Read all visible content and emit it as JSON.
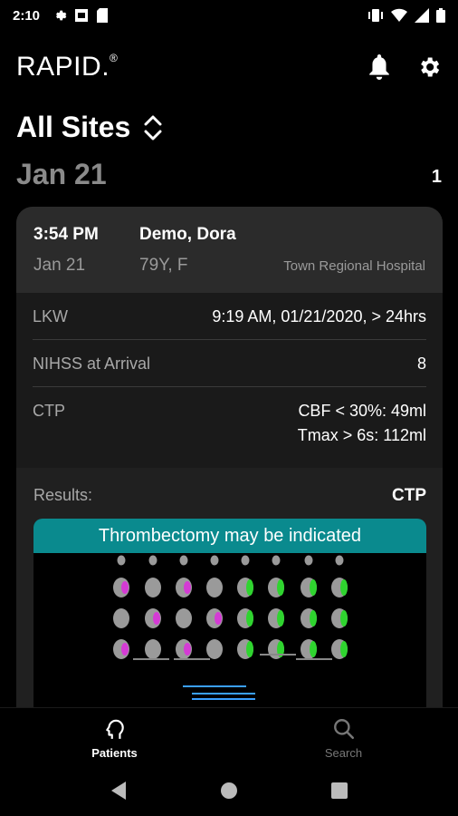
{
  "status": {
    "time": "2:10"
  },
  "app": {
    "logo": "RAPID",
    "logo_mark": "."
  },
  "site": {
    "title": "All Sites"
  },
  "group": {
    "date": "Jan 21",
    "count": "1"
  },
  "patient": {
    "time": "3:54 PM",
    "date": "Jan 21",
    "name": "Demo, Dora",
    "age_sex": "79Y, F",
    "hospital": "Town Regional Hospital",
    "rows": [
      {
        "label": "LKW",
        "value": "9:19 AM, 01/21/2020, > 24hrs"
      },
      {
        "label": "NIHSS at Arrival",
        "value": "8"
      },
      {
        "label": "CTP",
        "value_line1": "CBF < 30%: 49ml",
        "value_line2": "Tmax > 6s: 112ml"
      }
    ],
    "results_label": "Results:",
    "results_value": "CTP",
    "banner": "Thrombectomy may be indicated"
  },
  "nav": {
    "patients": "Patients",
    "search": "Search"
  },
  "colors": {
    "accent": "#0a8a8e",
    "perfusion_core": "#d43bd4",
    "perfusion_tmax": "#2fd42f"
  }
}
